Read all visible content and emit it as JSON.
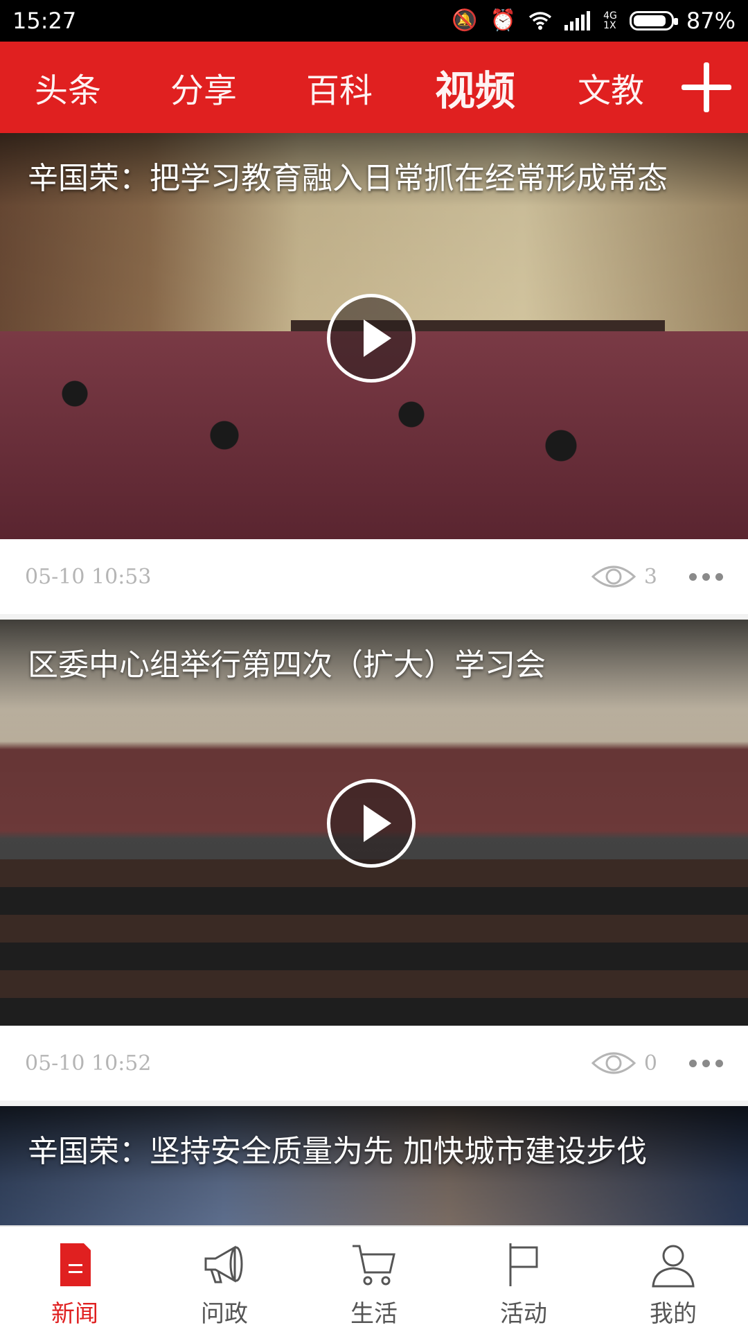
{
  "status_bar": {
    "time": "15:27",
    "network_top": "4G",
    "network_bottom": "1X",
    "battery": "87%"
  },
  "top_nav": {
    "tabs": [
      {
        "label": "头条"
      },
      {
        "label": "分享"
      },
      {
        "label": "百科"
      },
      {
        "label": "视频"
      },
      {
        "label": "文教"
      }
    ],
    "active_tab": "视频",
    "add_icon": "plus-icon"
  },
  "feed": [
    {
      "title": "辛国荣：把学习教育融入日常抓在经常形成常态",
      "time": "05-10 10:53",
      "views": "3"
    },
    {
      "title": "区委中心组举行第四次（扩大）学习会",
      "time": "05-10 10:52",
      "views": "0"
    },
    {
      "title": "辛国荣：坚持安全质量为先 加快城市建设步伐"
    }
  ],
  "bottom_nav": {
    "items": [
      {
        "label": "新闻",
        "icon": "news-document-icon"
      },
      {
        "label": "问政",
        "icon": "megaphone-icon"
      },
      {
        "label": "生活",
        "icon": "shopping-cart-icon"
      },
      {
        "label": "活动",
        "icon": "flag-icon"
      },
      {
        "label": "我的",
        "icon": "person-icon"
      }
    ],
    "active": "新闻"
  },
  "colors": {
    "brand_red": "#e02020",
    "meta_gray": "#b5b5b5"
  }
}
